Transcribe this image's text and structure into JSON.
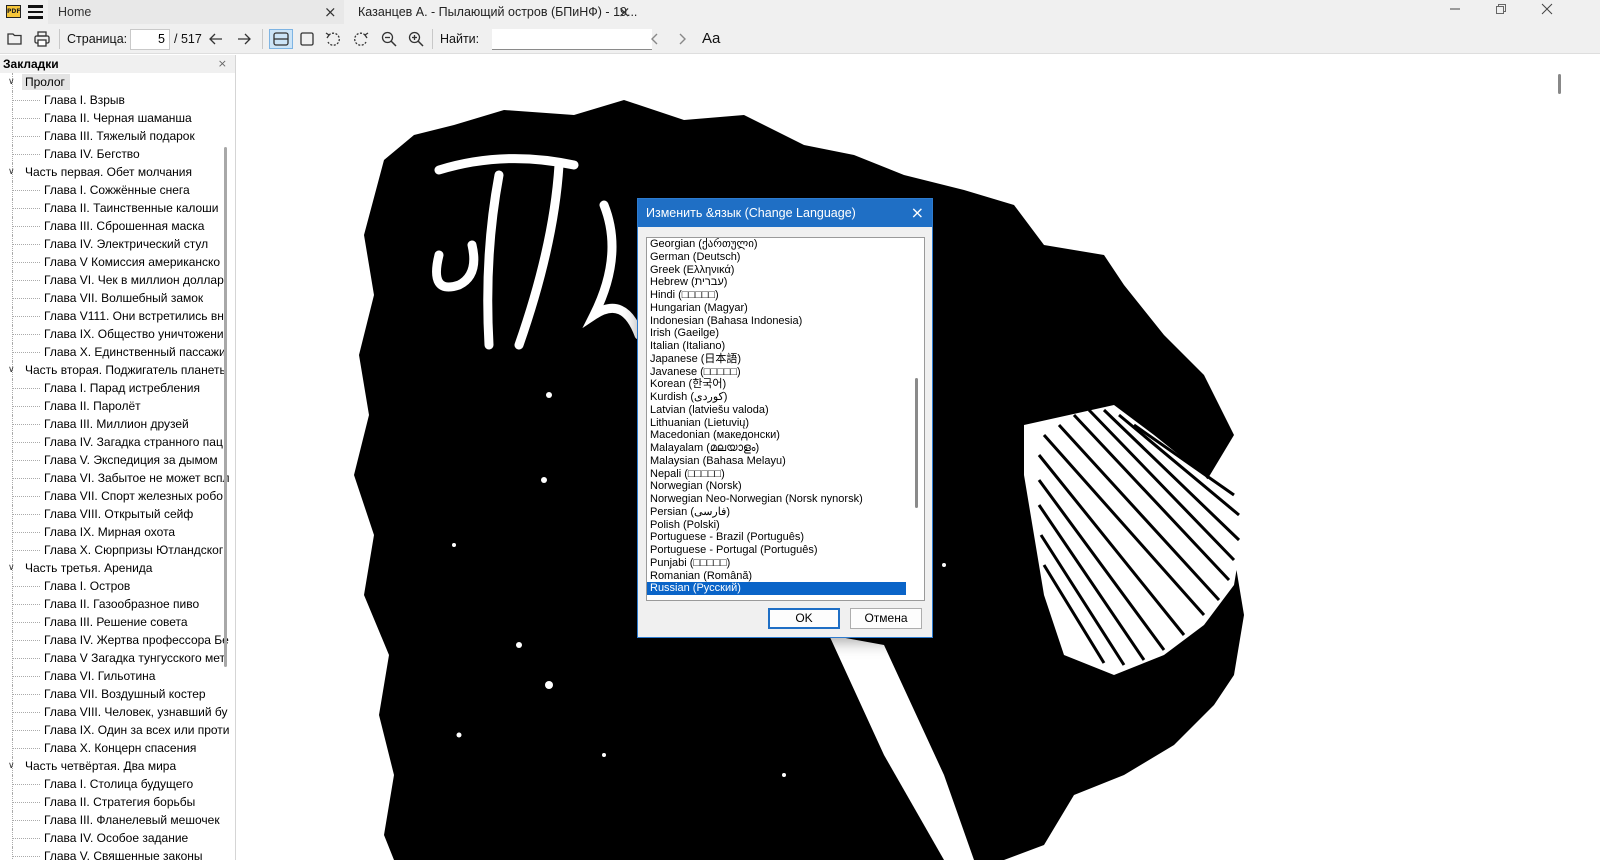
{
  "titlebar": {
    "app_icon": "PDF",
    "tabs": [
      {
        "label": "Home"
      },
      {
        "label": "Казанцев А. - Пылающий остров (БПиНФ) - 19..."
      }
    ],
    "close_glyph": "×"
  },
  "toolbar": {
    "page_label": "Страница:",
    "page_current": "5",
    "page_total": "/ 517",
    "find_label": "Найти:",
    "find_value": "",
    "text_options": "Aa"
  },
  "sidebar": {
    "header": "Закладки",
    "close_glyph": "×",
    "items": [
      {
        "level": 0,
        "label": "Пролог",
        "expanded": true,
        "selected": true
      },
      {
        "level": 1,
        "label": "Глава I. Взрыв"
      },
      {
        "level": 1,
        "label": "Глава II. Черная шаманша"
      },
      {
        "level": 1,
        "label": "Глава III. Тяжелый подарок"
      },
      {
        "level": 1,
        "label": "Глава IV. Бегство"
      },
      {
        "level": 0,
        "label": "Часть первая. Обет молчания",
        "expanded": true
      },
      {
        "level": 1,
        "label": "Глава I. Сожжённые снега"
      },
      {
        "level": 1,
        "label": "Глава II. Таинственные калоши"
      },
      {
        "level": 1,
        "label": "Глава III. Сброшенная маска"
      },
      {
        "level": 1,
        "label": "Глава IV. Электрический стул"
      },
      {
        "level": 1,
        "label": "Глава V Комиссия американско"
      },
      {
        "level": 1,
        "label": "Глава VI. Чек в миллион доллар"
      },
      {
        "level": 1,
        "label": "Глава VII. Волшебный замок"
      },
      {
        "level": 1,
        "label": "Глава V111. Они встретились вн"
      },
      {
        "level": 1,
        "label": "Глава IX. Общество уничтожени"
      },
      {
        "level": 1,
        "label": "Глава X. Единственный пассажи"
      },
      {
        "level": 0,
        "label": "Часть вторая. Поджигатель планеть",
        "expanded": true
      },
      {
        "level": 1,
        "label": "Глава I. Парад истребления"
      },
      {
        "level": 1,
        "label": "Глава II. Паролёт"
      },
      {
        "level": 1,
        "label": "Глава III. Миллион друзей"
      },
      {
        "level": 1,
        "label": "Глава IV. Загадка странного пац"
      },
      {
        "level": 1,
        "label": "Глава V. Экспедиция за дымом"
      },
      {
        "level": 1,
        "label": "Глава VI. Забытое не может вспл"
      },
      {
        "level": 1,
        "label": "Глава VII. Спорт железных робо"
      },
      {
        "level": 1,
        "label": "Глава VIII. Открытый сейф"
      },
      {
        "level": 1,
        "label": "Глава IX. Мирная охота"
      },
      {
        "level": 1,
        "label": "Глава X. Сюрпризы Ютландског"
      },
      {
        "level": 0,
        "label": "Часть третья. Аренида",
        "expanded": true
      },
      {
        "level": 1,
        "label": "Глава I. Остров"
      },
      {
        "level": 1,
        "label": "Глава II. Газообразное пиво"
      },
      {
        "level": 1,
        "label": "Глава III. Решение совета"
      },
      {
        "level": 1,
        "label": "Глава IV. Жертва профессора Бе"
      },
      {
        "level": 1,
        "label": "Глава V Загадка тунгусского мет"
      },
      {
        "level": 1,
        "label": "Глава VI. Гильотина"
      },
      {
        "level": 1,
        "label": "Глава VII. Воздушный костер"
      },
      {
        "level": 1,
        "label": "Глава VIII. Человек, узнавший бу"
      },
      {
        "level": 1,
        "label": "Глава IX. Один за всех или проти"
      },
      {
        "level": 1,
        "label": "Глава X. Концерн спасения"
      },
      {
        "level": 0,
        "label": "Часть четвёртая. Два мира",
        "expanded": true
      },
      {
        "level": 1,
        "label": "Глава I. Столица будущего"
      },
      {
        "level": 1,
        "label": "Глава II. Стратегия борьбы"
      },
      {
        "level": 1,
        "label": "Глава III. Фланелевый мешочек"
      },
      {
        "level": 1,
        "label": "Глава IV. Особое задание"
      },
      {
        "level": 1,
        "label": "Глава V. Священные законы"
      }
    ]
  },
  "dialog": {
    "title": "Изменить &язык (Change Language)",
    "close_glyph": "×",
    "languages": [
      "Georgian (ქართული)",
      "German (Deutsch)",
      "Greek (Ελληνικά)",
      "Hebrew (עברית)",
      "Hindi (□□□□□)",
      "Hungarian (Magyar)",
      "Indonesian (Bahasa Indonesia)",
      "Irish (Gaeilge)",
      "Italian (Italiano)",
      "Japanese (日本語)",
      "Javanese (□□□□□)",
      "Korean (한국어)",
      "Kurdish (کوردی)",
      "Latvian (latviešu valoda)",
      "Lithuanian (Lietuvių)",
      "Macedonian (македонски)",
      "Malayalam (മലയാളം)",
      "Malaysian (Bahasa Melayu)",
      "Nepali (□□□□□)",
      "Norwegian (Norsk)",
      "Norwegian Neo-Norwegian (Norsk nynorsk)",
      "Persian (فارسی)",
      "Polish (Polski)",
      "Portuguese - Brazil (Português)",
      "Portuguese - Portugal (Português)",
      "Punjabi (□□□□□)",
      "Romanian (Română)",
      "Russian (Русский)"
    ],
    "selected_language": "Russian (Русский)",
    "ok_label": "OK",
    "cancel_label": "Отмена"
  },
  "colors": {
    "accent": "#1f6fc5",
    "selection": "#0a64c8",
    "chrome": "#f0f0f0"
  }
}
